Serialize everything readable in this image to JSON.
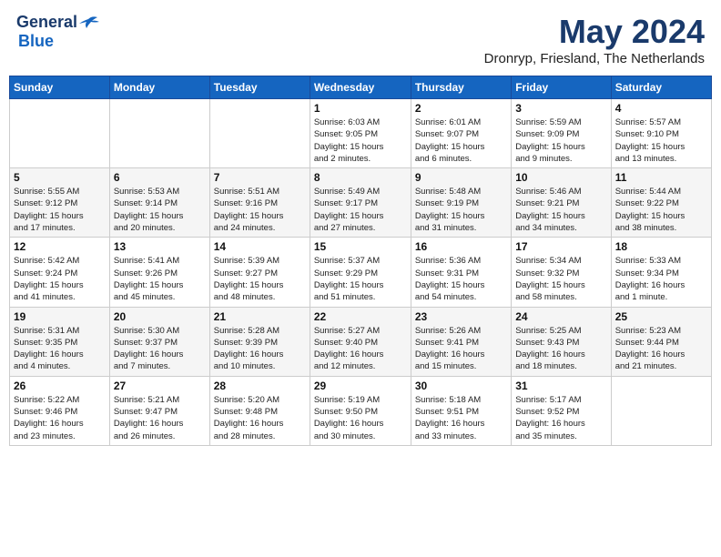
{
  "logo": {
    "line1": "General",
    "line2": "Blue"
  },
  "title": "May 2024",
  "subtitle": "Dronryp, Friesland, The Netherlands",
  "weekdays": [
    "Sunday",
    "Monday",
    "Tuesday",
    "Wednesday",
    "Thursday",
    "Friday",
    "Saturday"
  ],
  "weeks": [
    [
      {
        "day": "",
        "info": ""
      },
      {
        "day": "",
        "info": ""
      },
      {
        "day": "",
        "info": ""
      },
      {
        "day": "1",
        "info": "Sunrise: 6:03 AM\nSunset: 9:05 PM\nDaylight: 15 hours\nand 2 minutes."
      },
      {
        "day": "2",
        "info": "Sunrise: 6:01 AM\nSunset: 9:07 PM\nDaylight: 15 hours\nand 6 minutes."
      },
      {
        "day": "3",
        "info": "Sunrise: 5:59 AM\nSunset: 9:09 PM\nDaylight: 15 hours\nand 9 minutes."
      },
      {
        "day": "4",
        "info": "Sunrise: 5:57 AM\nSunset: 9:10 PM\nDaylight: 15 hours\nand 13 minutes."
      }
    ],
    [
      {
        "day": "5",
        "info": "Sunrise: 5:55 AM\nSunset: 9:12 PM\nDaylight: 15 hours\nand 17 minutes."
      },
      {
        "day": "6",
        "info": "Sunrise: 5:53 AM\nSunset: 9:14 PM\nDaylight: 15 hours\nand 20 minutes."
      },
      {
        "day": "7",
        "info": "Sunrise: 5:51 AM\nSunset: 9:16 PM\nDaylight: 15 hours\nand 24 minutes."
      },
      {
        "day": "8",
        "info": "Sunrise: 5:49 AM\nSunset: 9:17 PM\nDaylight: 15 hours\nand 27 minutes."
      },
      {
        "day": "9",
        "info": "Sunrise: 5:48 AM\nSunset: 9:19 PM\nDaylight: 15 hours\nand 31 minutes."
      },
      {
        "day": "10",
        "info": "Sunrise: 5:46 AM\nSunset: 9:21 PM\nDaylight: 15 hours\nand 34 minutes."
      },
      {
        "day": "11",
        "info": "Sunrise: 5:44 AM\nSunset: 9:22 PM\nDaylight: 15 hours\nand 38 minutes."
      }
    ],
    [
      {
        "day": "12",
        "info": "Sunrise: 5:42 AM\nSunset: 9:24 PM\nDaylight: 15 hours\nand 41 minutes."
      },
      {
        "day": "13",
        "info": "Sunrise: 5:41 AM\nSunset: 9:26 PM\nDaylight: 15 hours\nand 45 minutes."
      },
      {
        "day": "14",
        "info": "Sunrise: 5:39 AM\nSunset: 9:27 PM\nDaylight: 15 hours\nand 48 minutes."
      },
      {
        "day": "15",
        "info": "Sunrise: 5:37 AM\nSunset: 9:29 PM\nDaylight: 15 hours\nand 51 minutes."
      },
      {
        "day": "16",
        "info": "Sunrise: 5:36 AM\nSunset: 9:31 PM\nDaylight: 15 hours\nand 54 minutes."
      },
      {
        "day": "17",
        "info": "Sunrise: 5:34 AM\nSunset: 9:32 PM\nDaylight: 15 hours\nand 58 minutes."
      },
      {
        "day": "18",
        "info": "Sunrise: 5:33 AM\nSunset: 9:34 PM\nDaylight: 16 hours\nand 1 minute."
      }
    ],
    [
      {
        "day": "19",
        "info": "Sunrise: 5:31 AM\nSunset: 9:35 PM\nDaylight: 16 hours\nand 4 minutes."
      },
      {
        "day": "20",
        "info": "Sunrise: 5:30 AM\nSunset: 9:37 PM\nDaylight: 16 hours\nand 7 minutes."
      },
      {
        "day": "21",
        "info": "Sunrise: 5:28 AM\nSunset: 9:39 PM\nDaylight: 16 hours\nand 10 minutes."
      },
      {
        "day": "22",
        "info": "Sunrise: 5:27 AM\nSunset: 9:40 PM\nDaylight: 16 hours\nand 12 minutes."
      },
      {
        "day": "23",
        "info": "Sunrise: 5:26 AM\nSunset: 9:41 PM\nDaylight: 16 hours\nand 15 minutes."
      },
      {
        "day": "24",
        "info": "Sunrise: 5:25 AM\nSunset: 9:43 PM\nDaylight: 16 hours\nand 18 minutes."
      },
      {
        "day": "25",
        "info": "Sunrise: 5:23 AM\nSunset: 9:44 PM\nDaylight: 16 hours\nand 21 minutes."
      }
    ],
    [
      {
        "day": "26",
        "info": "Sunrise: 5:22 AM\nSunset: 9:46 PM\nDaylight: 16 hours\nand 23 minutes."
      },
      {
        "day": "27",
        "info": "Sunrise: 5:21 AM\nSunset: 9:47 PM\nDaylight: 16 hours\nand 26 minutes."
      },
      {
        "day": "28",
        "info": "Sunrise: 5:20 AM\nSunset: 9:48 PM\nDaylight: 16 hours\nand 28 minutes."
      },
      {
        "day": "29",
        "info": "Sunrise: 5:19 AM\nSunset: 9:50 PM\nDaylight: 16 hours\nand 30 minutes."
      },
      {
        "day": "30",
        "info": "Sunrise: 5:18 AM\nSunset: 9:51 PM\nDaylight: 16 hours\nand 33 minutes."
      },
      {
        "day": "31",
        "info": "Sunrise: 5:17 AM\nSunset: 9:52 PM\nDaylight: 16 hours\nand 35 minutes."
      },
      {
        "day": "",
        "info": ""
      }
    ]
  ]
}
